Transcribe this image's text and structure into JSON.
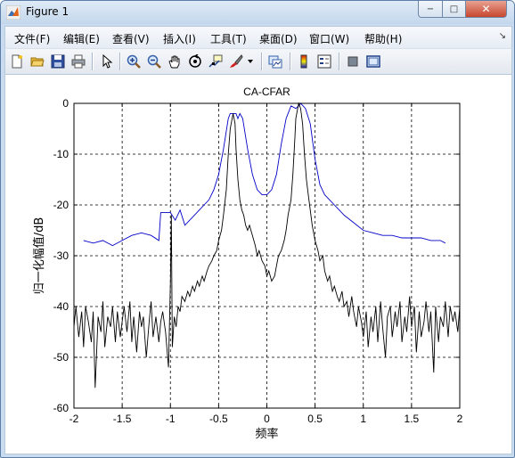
{
  "window": {
    "title": "Figure 1",
    "buttons": {
      "minimize": "−",
      "maximize": "□",
      "close": "✕"
    }
  },
  "menu": {
    "items": [
      {
        "label": "文件(F)"
      },
      {
        "label": "编辑(E)"
      },
      {
        "label": "查看(V)"
      },
      {
        "label": "插入(I)"
      },
      {
        "label": "工具(T)"
      },
      {
        "label": "桌面(D)"
      },
      {
        "label": "窗口(W)"
      },
      {
        "label": "帮助(H)"
      }
    ],
    "overflow_icon": "menu-overflow-icon"
  },
  "toolbar": {
    "icons": [
      "new-file-icon",
      "open-folder-icon",
      "save-icon",
      "print-icon",
      "pointer-icon",
      "zoom-in-icon",
      "zoom-out-icon",
      "pan-hand-icon",
      "rotate-3d-icon",
      "data-cursor-icon",
      "brush-icon",
      "brush-dropdown-icon",
      "link-plot-icon",
      "colorbar-icon",
      "legend-icon",
      "hide-plot-tools-icon",
      "show-plot-tools-icon"
    ]
  },
  "chart_data": {
    "type": "line",
    "title": "CA-CFAR",
    "xlabel": "频率",
    "ylabel": "归一化幅值/dB",
    "xlim": [
      -2,
      2
    ],
    "ylim": [
      -60,
      0
    ],
    "xticks": [
      "-2",
      "-1.5",
      "-1",
      "-0.5",
      "0",
      "0.5",
      "1",
      "1.5",
      "2"
    ],
    "yticks": [
      "0",
      "-10",
      "-20",
      "-30",
      "-40",
      "-50",
      "-60"
    ],
    "grid": true,
    "series": [
      {
        "color": "#0000c8",
        "x": [
          -1.9,
          -1.8,
          -1.7,
          -1.6,
          -1.5,
          -1.4,
          -1.3,
          -1.2,
          -1.12,
          -1.1,
          -1.05,
          -1.0,
          -0.95,
          -0.9,
          -0.85,
          -0.8,
          -0.75,
          -0.7,
          -0.65,
          -0.6,
          -0.55,
          -0.5,
          -0.45,
          -0.4,
          -0.38,
          -0.35,
          -0.32,
          -0.3,
          -0.28,
          -0.25,
          -0.2,
          -0.15,
          -0.1,
          -0.05,
          0.0,
          0.05,
          0.1,
          0.15,
          0.2,
          0.25,
          0.3,
          0.33,
          0.35,
          0.4,
          0.45,
          0.5,
          0.55,
          0.6,
          0.7,
          0.8,
          0.9,
          1.0,
          1.1,
          1.2,
          1.3,
          1.4,
          1.5,
          1.6,
          1.7,
          1.8,
          1.85
        ],
        "y": [
          -27,
          -27.5,
          -27,
          -28,
          -27,
          -26,
          -25.5,
          -26,
          -27,
          -21.5,
          -21.5,
          -21.5,
          -23,
          -21,
          -24,
          -23,
          -22,
          -21,
          -20,
          -19,
          -17,
          -14,
          -9,
          -3,
          -2,
          -2,
          -2,
          -3,
          -2,
          -3,
          -9,
          -14,
          -17,
          -18,
          -18,
          -17,
          -14,
          -8,
          -3,
          -0.5,
          -1,
          -0.5,
          0,
          -1,
          -4,
          -11,
          -16,
          -18,
          -20,
          -22,
          -23.5,
          -25,
          -25.5,
          -26,
          -26,
          -26.5,
          -26.5,
          -26.5,
          -27,
          -27,
          -27.5
        ]
      },
      {
        "color": "#000000",
        "x": [
          -2.0,
          -1.98,
          -1.95,
          -1.92,
          -1.9,
          -1.88,
          -1.85,
          -1.82,
          -1.8,
          -1.78,
          -1.75,
          -1.72,
          -1.7,
          -1.68,
          -1.65,
          -1.62,
          -1.6,
          -1.57,
          -1.55,
          -1.52,
          -1.5,
          -1.48,
          -1.45,
          -1.42,
          -1.4,
          -1.38,
          -1.35,
          -1.32,
          -1.3,
          -1.28,
          -1.25,
          -1.22,
          -1.2,
          -1.18,
          -1.15,
          -1.12,
          -1.1,
          -1.08,
          -1.05,
          -1.02,
          -1.0,
          -0.99,
          -0.98,
          -0.96,
          -0.94,
          -0.92,
          -0.9,
          -0.88,
          -0.85,
          -0.82,
          -0.8,
          -0.77,
          -0.75,
          -0.72,
          -0.7,
          -0.67,
          -0.65,
          -0.62,
          -0.6,
          -0.57,
          -0.55,
          -0.52,
          -0.5,
          -0.47,
          -0.45,
          -0.42,
          -0.4,
          -0.38,
          -0.36,
          -0.35,
          -0.33,
          -0.32,
          -0.3,
          -0.28,
          -0.26,
          -0.24,
          -0.22,
          -0.2,
          -0.18,
          -0.15,
          -0.12,
          -0.1,
          -0.08,
          -0.05,
          -0.02,
          0.0,
          0.02,
          0.05,
          0.08,
          0.1,
          0.12,
          0.15,
          0.18,
          0.2,
          0.22,
          0.25,
          0.27,
          0.29,
          0.3,
          0.32,
          0.33,
          0.35,
          0.37,
          0.39,
          0.41,
          0.43,
          0.45,
          0.47,
          0.5,
          0.53,
          0.55,
          0.58,
          0.6,
          0.63,
          0.65,
          0.68,
          0.7,
          0.73,
          0.75,
          0.78,
          0.8,
          0.83,
          0.85,
          0.88,
          0.9,
          0.93,
          0.95,
          0.98,
          1.0,
          1.03,
          1.05,
          1.08,
          1.1,
          1.13,
          1.15,
          1.18,
          1.2,
          1.23,
          1.25,
          1.28,
          1.3,
          1.33,
          1.35,
          1.38,
          1.4,
          1.43,
          1.45,
          1.48,
          1.5,
          1.53,
          1.55,
          1.58,
          1.6,
          1.63,
          1.65,
          1.68,
          1.7,
          1.73,
          1.75,
          1.78,
          1.8,
          1.83,
          1.85,
          1.88,
          1.9,
          1.93,
          1.95,
          1.98,
          2.0
        ],
        "y": [
          -44,
          -40,
          -46,
          -41,
          -48,
          -40,
          -43,
          -47,
          -41,
          -56,
          -42,
          -45,
          -39,
          -48,
          -42,
          -44,
          -40,
          -47,
          -41,
          -46,
          -43,
          -40,
          -45,
          -39,
          -47,
          -42,
          -49,
          -41,
          -44,
          -42,
          -50,
          -43,
          -39,
          -46,
          -42,
          -47,
          -43,
          -41,
          -45,
          -52,
          -35,
          -22,
          -48,
          -42,
          -44,
          -40,
          -41,
          -38,
          -39,
          -37,
          -38,
          -36,
          -37,
          -35,
          -36,
          -34,
          -35,
          -33,
          -32,
          -31,
          -30,
          -29,
          -27,
          -25,
          -22,
          -17,
          -10,
          -5,
          -3,
          -2,
          -4,
          -9,
          -15,
          -19,
          -21,
          -22,
          -24,
          -25,
          -24,
          -26,
          -28,
          -30,
          -29,
          -31,
          -32,
          -34,
          -33,
          -35,
          -34,
          -32,
          -30,
          -29,
          -27,
          -25,
          -22,
          -19,
          -14,
          -7,
          -3,
          -1,
          0,
          -1,
          -4,
          -10,
          -15,
          -18,
          -21,
          -24,
          -27,
          -29,
          -31,
          -30,
          -33,
          -35,
          -34,
          -37,
          -36,
          -38,
          -39,
          -37,
          -40,
          -39,
          -42,
          -38,
          -41,
          -44,
          -40,
          -43,
          -46,
          -41,
          -48,
          -42,
          -45,
          -40,
          -47,
          -39,
          -44,
          -50,
          -42,
          -40,
          -46,
          -41,
          -44,
          -39,
          -47,
          -42,
          -45,
          -38,
          -44,
          -40,
          -49,
          -41,
          -46,
          -43,
          -39,
          -45,
          -41,
          -53,
          -40,
          -47,
          -42,
          -44,
          -39,
          -46,
          -40,
          -43,
          -41,
          -45,
          -40
        ]
      }
    ]
  }
}
